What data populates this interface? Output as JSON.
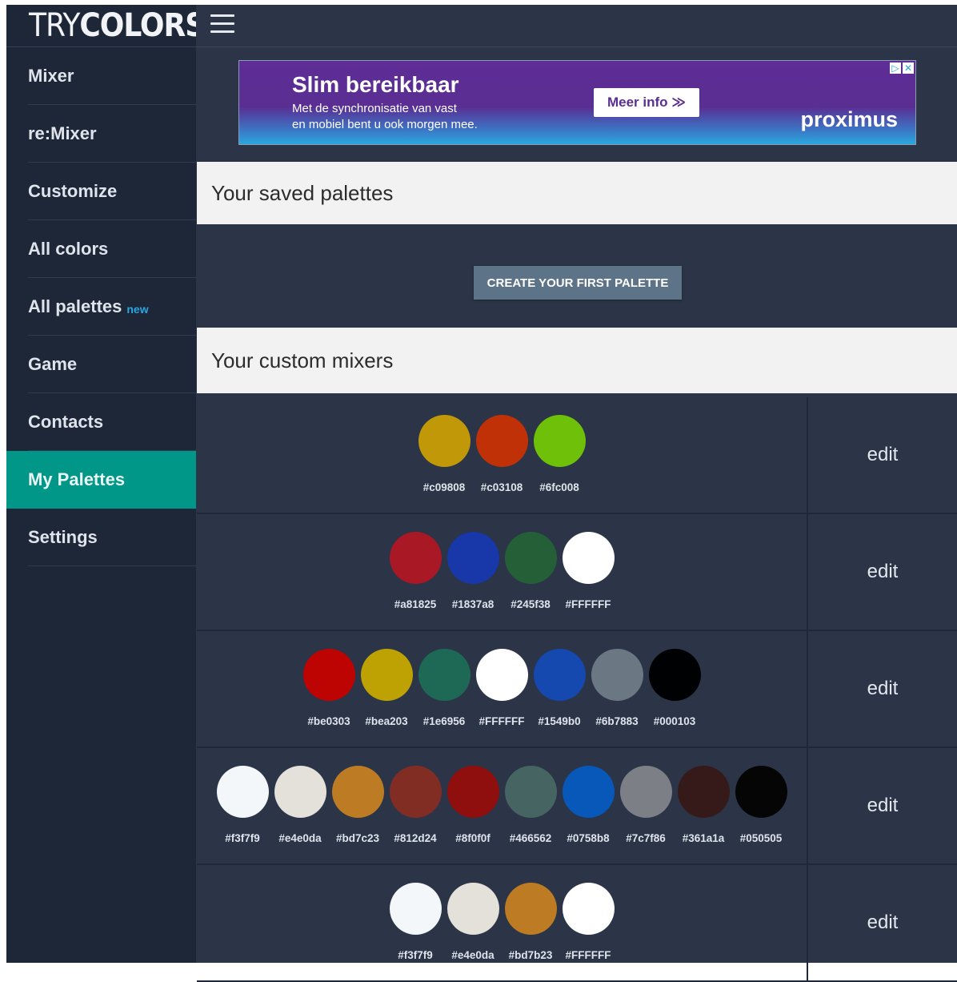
{
  "logo": {
    "part1": "TRY",
    "part2": "COLORS"
  },
  "sidebar": {
    "items": [
      {
        "label": "Mixer"
      },
      {
        "label": "re:Mixer"
      },
      {
        "label": "Customize"
      },
      {
        "label": "All colors"
      },
      {
        "label": "All palettes",
        "badge": "new"
      },
      {
        "label": "Game"
      },
      {
        "label": "Contacts"
      },
      {
        "label": "My Palettes",
        "active": true
      },
      {
        "label": "Settings"
      }
    ]
  },
  "ad": {
    "title": "Slim bereikbaar",
    "line1": "Met de synchronisatie van vast",
    "line2": "en mobiel bent u ook morgen mee.",
    "button": "Meer info ≫",
    "brand": "proximus"
  },
  "saved": {
    "title": "Your saved palettes",
    "create_button": "CREATE YOUR FIRST PALETTE"
  },
  "custom": {
    "title": "Your custom mixers",
    "edit_label": "edit"
  },
  "mixers": [
    {
      "colors": [
        "#c09808",
        "#c03108",
        "#6fc008"
      ]
    },
    {
      "colors": [
        "#a81825",
        "#1837a8",
        "#245f38",
        "#FFFFFF"
      ]
    },
    {
      "colors": [
        "#be0303",
        "#bea203",
        "#1e6956",
        "#FFFFFF",
        "#1549b0",
        "#6b7883",
        "#000103"
      ]
    },
    {
      "colors": [
        "#f3f7f9",
        "#e4e0da",
        "#bd7c23",
        "#812d24",
        "#8f0f0f",
        "#466562",
        "#0758b8",
        "#7c7f86",
        "#361a1a",
        "#050505"
      ]
    },
    {
      "colors": [
        "#f3f7f9",
        "#e4e0da",
        "#bd7b23",
        "#FFFFFF"
      ]
    }
  ]
}
